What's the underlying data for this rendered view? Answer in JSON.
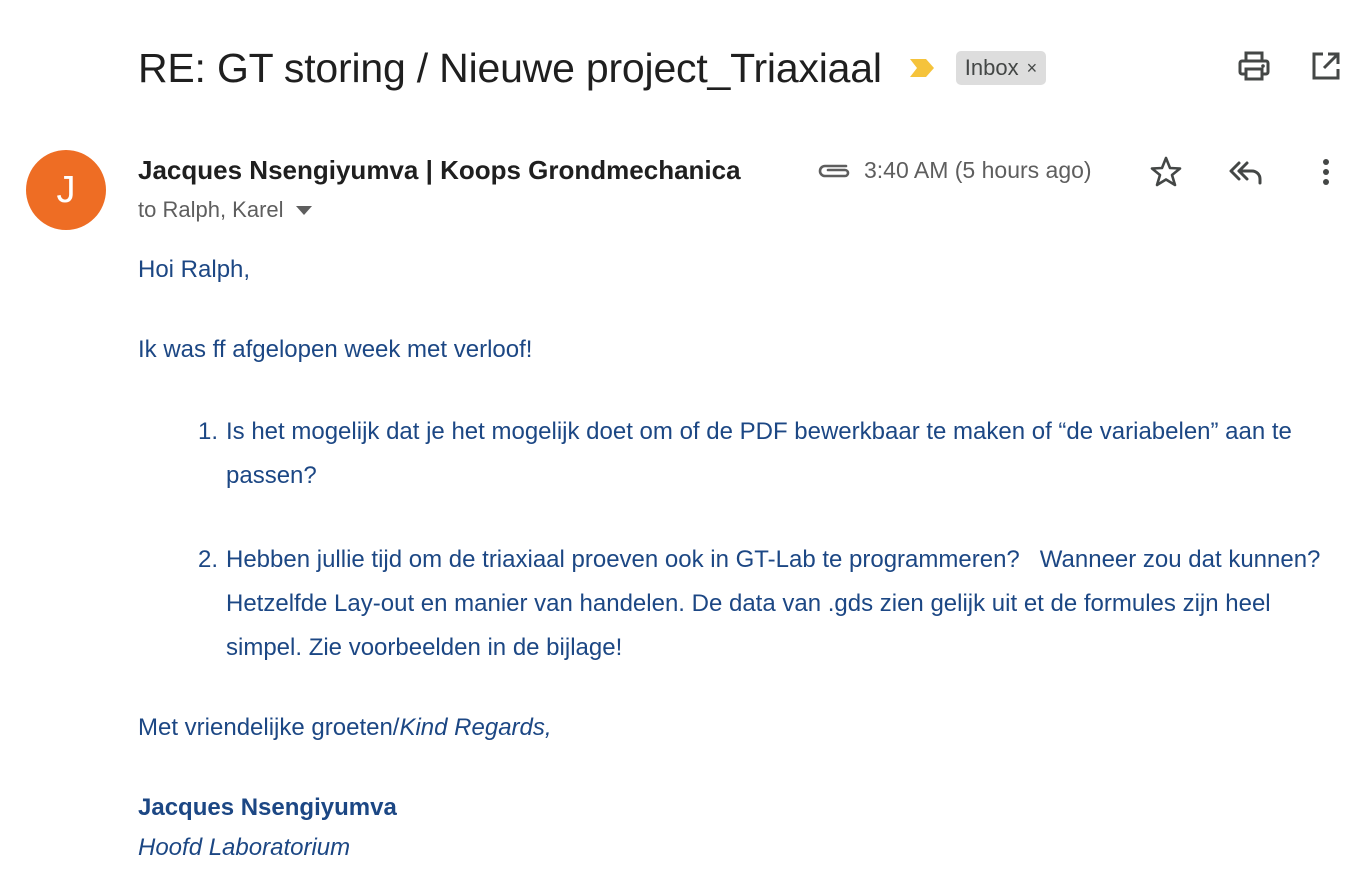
{
  "subject": {
    "title": "RE: GT storing / Nieuwe project_Triaxiaal",
    "label": "Inbox",
    "label_remove": "×",
    "importance_icon": "importance-marker-icon",
    "importance_color": "#f5c33b"
  },
  "toolbar": {
    "print_icon": "print-icon",
    "open_new_window_icon": "open-in-new-window-icon"
  },
  "message": {
    "avatar_letter": "J",
    "avatar_color": "#ee6d24",
    "sender": "Jacques Nsengiyumva | Koops Grondmechanica",
    "attachment_icon": "paperclip-icon",
    "time": "3:40 AM (5 hours ago)",
    "recipients": "to Ralph, Karel",
    "star_icon": "star-icon",
    "reply_all_icon": "reply-all-icon",
    "more_icon": "more-vertical-icon"
  },
  "body": {
    "greeting": "Hoi Ralph,",
    "intro": "Ik was ff afgelopen week met verloof!",
    "items": [
      {
        "number": "1.",
        "text": "Is het mogelijk dat je het mogelijk doet om of de PDF bewerkbaar te maken of “de variabelen” aan te passen?"
      },
      {
        "number": "2.",
        "text": "Hebben jullie tijd om de triaxiaal proeven ook in GT-Lab te programmeren?   Wanneer zou dat kunnen? Hetzelfde Lay-out en manier van handelen. De data van .gds zien gelijk uit et de formules zijn heel simpel. Zie voorbeelden in de bijlage!"
      }
    ],
    "closing_regular": "Met vriendelijke groeten/",
    "closing_italic": "Kind Regards,",
    "signature_name": "Jacques Nsengiyumva",
    "signature_title": "Hoofd Laboratorium",
    "text_color": "#1c4784"
  }
}
